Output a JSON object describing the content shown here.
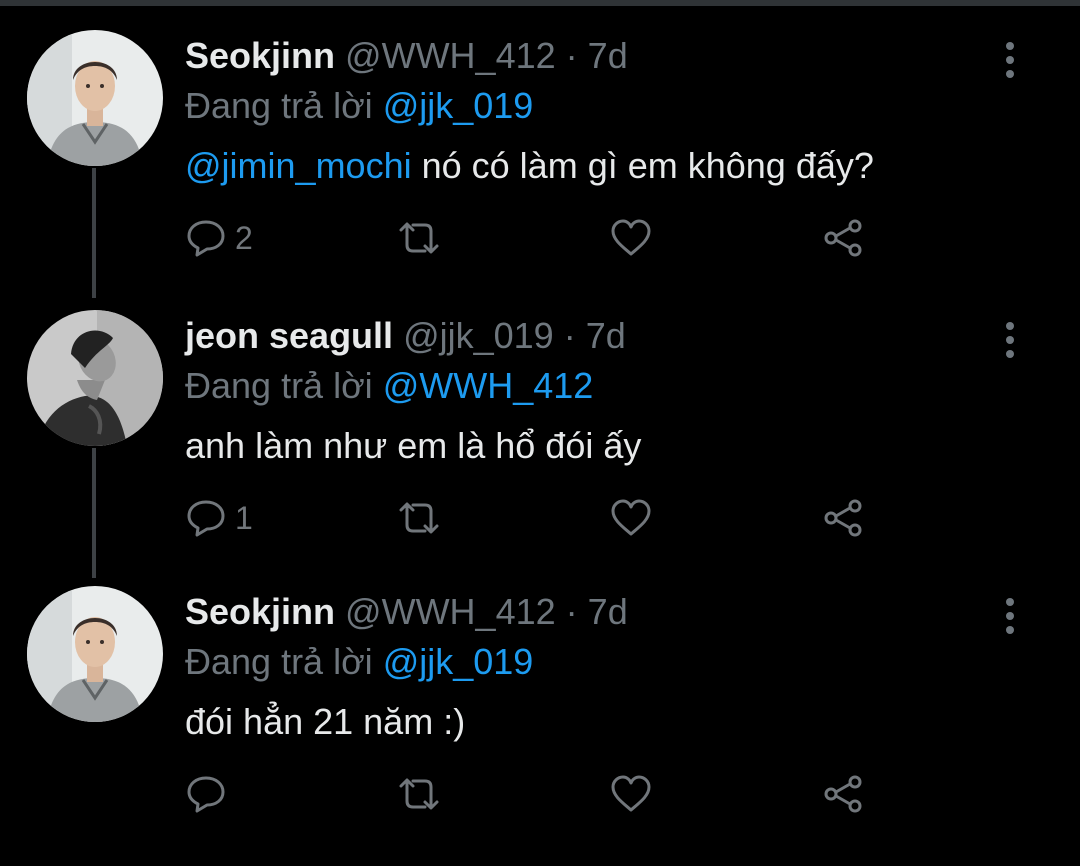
{
  "colors": {
    "background": "#000000",
    "text": "#e7e9ea",
    "muted": "#6e767d",
    "link": "#1d9bf0"
  },
  "tweets": [
    {
      "display_name": "Seokjinn",
      "handle": "@WWH_412",
      "separator": "·",
      "time": "7d",
      "reply_prefix": "Đang trả lời",
      "reply_to": "@jjk_019",
      "mention": "@jimin_mochi",
      "text": " nó có làm gì em không đấy?",
      "reply_count": "2",
      "icons": [
        "reply-icon",
        "retweet-icon",
        "like-icon",
        "share-icon",
        "more-icon"
      ]
    },
    {
      "display_name": "jeon seagull",
      "handle": "@jjk_019",
      "separator": "·",
      "time": "7d",
      "reply_prefix": "Đang trả lời",
      "reply_to": "@WWH_412",
      "mention": "",
      "text": "anh làm như em là hổ đói ấy",
      "reply_count": "1",
      "icons": [
        "reply-icon",
        "retweet-icon",
        "like-icon",
        "share-icon",
        "more-icon"
      ]
    },
    {
      "display_name": "Seokjinn",
      "handle": "@WWH_412",
      "separator": "·",
      "time": "7d",
      "reply_prefix": "Đang trả lời",
      "reply_to": "@jjk_019",
      "mention": "",
      "text": "đói hẳn 21 năm :)",
      "reply_count": "",
      "icons": [
        "reply-icon",
        "retweet-icon",
        "like-icon",
        "share-icon",
        "more-icon"
      ]
    }
  ]
}
